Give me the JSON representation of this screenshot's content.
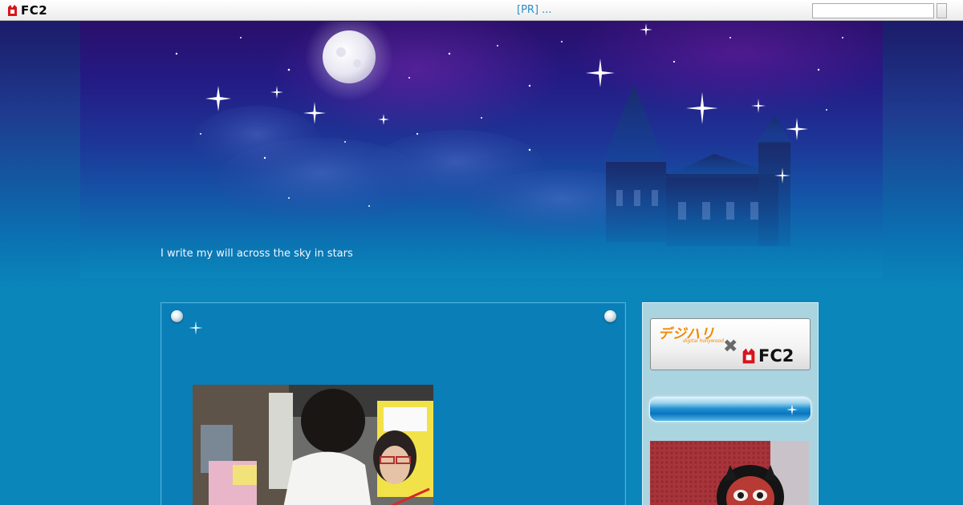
{
  "topbar": {
    "logo_text": "FC2",
    "pr_link": "[PR] ...",
    "search_value": ""
  },
  "header": {
    "tagline": "I write my will across the sky in stars"
  },
  "sidebar": {
    "banner_brand": "デジハリ",
    "banner_sub": "digital hollywood",
    "banner_cross": "✖",
    "banner_fc2": "FC2"
  },
  "colors": {
    "accent_blue": "#0a86bb",
    "link_blue": "#2a8ec9",
    "banner_orange": "#f08a00"
  }
}
